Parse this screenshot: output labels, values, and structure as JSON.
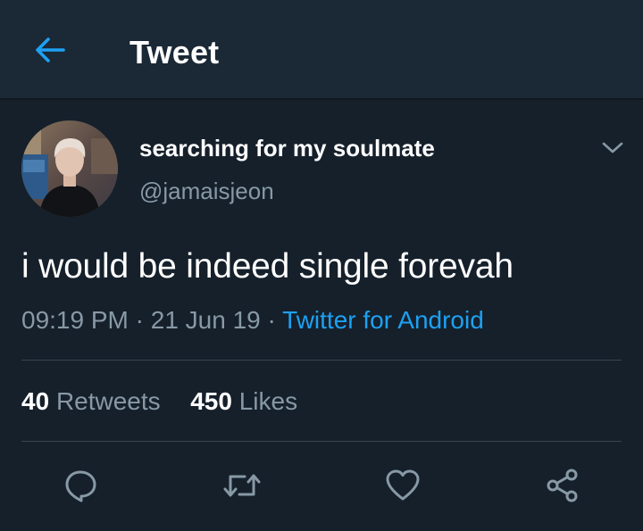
{
  "header": {
    "title": "Tweet",
    "back_icon": "arrow-left-icon",
    "accent_color": "#1da1f2"
  },
  "tweet": {
    "display_name": "searching for my soulmate",
    "handle": "@jamaisjeon",
    "text": "i would be indeed single forevah",
    "time": "09:19 PM",
    "separator": "·",
    "date": "21 Jun 19",
    "source": "Twitter for Android"
  },
  "stats": {
    "retweets_count": "40",
    "retweets_label": "Retweets",
    "likes_count": "450",
    "likes_label": "Likes"
  },
  "actions": [
    {
      "name": "reply",
      "icon": "reply-bubble-icon"
    },
    {
      "name": "retweet",
      "icon": "retweet-icon"
    },
    {
      "name": "like",
      "icon": "heart-icon"
    },
    {
      "name": "share",
      "icon": "share-icon"
    }
  ],
  "colors": {
    "background": "#15202b",
    "header_background": "#1b2836",
    "secondary_text": "#8899a6",
    "link": "#1da1f2",
    "divider": "#38444d"
  }
}
